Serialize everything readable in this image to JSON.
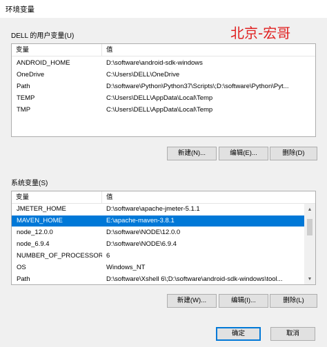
{
  "window": {
    "title": "环境变量"
  },
  "watermark": "北京-宏哥",
  "user_vars": {
    "label": "DELL 的用户变量(U)",
    "columns": [
      "变量",
      "值"
    ],
    "rows": [
      {
        "name": "ANDROID_HOME",
        "value": "D:\\software\\android-sdk-windows"
      },
      {
        "name": "OneDrive",
        "value": "C:\\Users\\DELL\\OneDrive"
      },
      {
        "name": "Path",
        "value": "D:\\software\\Python\\Python37\\Scripts\\;D:\\software\\Python\\Pyt..."
      },
      {
        "name": "TEMP",
        "value": "C:\\Users\\DELL\\AppData\\Local\\Temp"
      },
      {
        "name": "TMP",
        "value": "C:\\Users\\DELL\\AppData\\Local\\Temp"
      }
    ],
    "buttons": {
      "new": "新建(N)...",
      "edit": "编辑(E)...",
      "delete": "删除(D)"
    }
  },
  "system_vars": {
    "label": "系统变量(S)",
    "columns": [
      "变量",
      "值"
    ],
    "rows": [
      {
        "name": "JMETER_HOME",
        "value": "D:\\software\\apache-jmeter-5.1.1"
      },
      {
        "name": "MAVEN_HOME",
        "value": "E:\\apache-maven-3.8.1",
        "selected": true
      },
      {
        "name": "node_12.0.0",
        "value": "D:\\software\\NODE\\12.0.0"
      },
      {
        "name": "node_6.9.4",
        "value": "D:\\software\\NODE\\6.9.4"
      },
      {
        "name": "NUMBER_OF_PROCESSORS",
        "value": "6"
      },
      {
        "name": "OS",
        "value": "Windows_NT"
      },
      {
        "name": "Path",
        "value": "D:\\software\\Xshell 6\\;D:\\software\\android-sdk-windows\\tool..."
      }
    ],
    "buttons": {
      "new": "新建(W)...",
      "edit": "编辑(I)...",
      "delete": "删除(L)"
    }
  },
  "dialog_buttons": {
    "ok": "确定",
    "cancel": "取消"
  },
  "colors": {
    "selection": "#0078d7",
    "watermark": "#e02020",
    "default_button_border": "#0078d7"
  }
}
